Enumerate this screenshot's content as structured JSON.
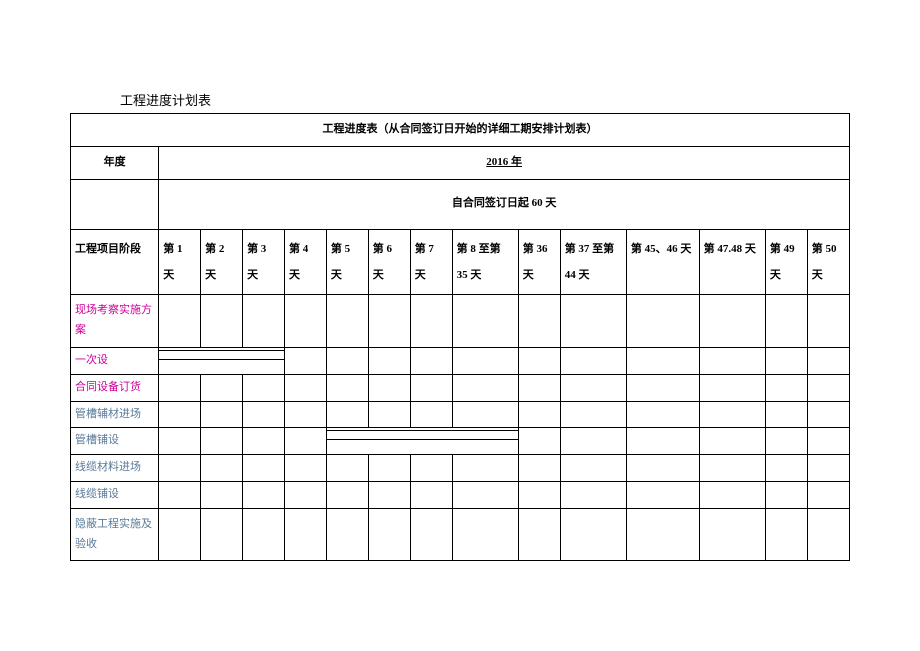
{
  "doc_title": "工程进度计划表",
  "table_title": "工程进度表（从合同签订日开始的详细工期安排计划表）",
  "year_label": "年度",
  "year_value": "2016 年",
  "duration_note": "自合同签订日起 60 天",
  "phase_header": "工程项目阶段",
  "columns": [
    "第 1 天",
    "第 2 天",
    "第 3 天",
    "第 4 天",
    "第 5 天",
    "第 6 天",
    "第 7 天",
    "第 8 至第 35 天",
    "第 36 天",
    "第 37 至第 44 天",
    "第 45、46 天",
    "第 47.48 天",
    "第 49 天",
    "第 50 天"
  ],
  "rows": [
    {
      "label": "现场考察实施方案",
      "color": "magenta"
    },
    {
      "label": "一次设",
      "color": "magenta"
    },
    {
      "label": "合同设备订货",
      "color": "magenta"
    },
    {
      "label": "管槽辅材进场",
      "color": "steel"
    },
    {
      "label": "管槽铺设",
      "color": "steel"
    },
    {
      "label": "线缆材料进场",
      "color": "steel"
    },
    {
      "label": "线缆铺设",
      "color": "steel"
    },
    {
      "label": "隐蔽工程实施及验收",
      "color": "steel"
    }
  ]
}
